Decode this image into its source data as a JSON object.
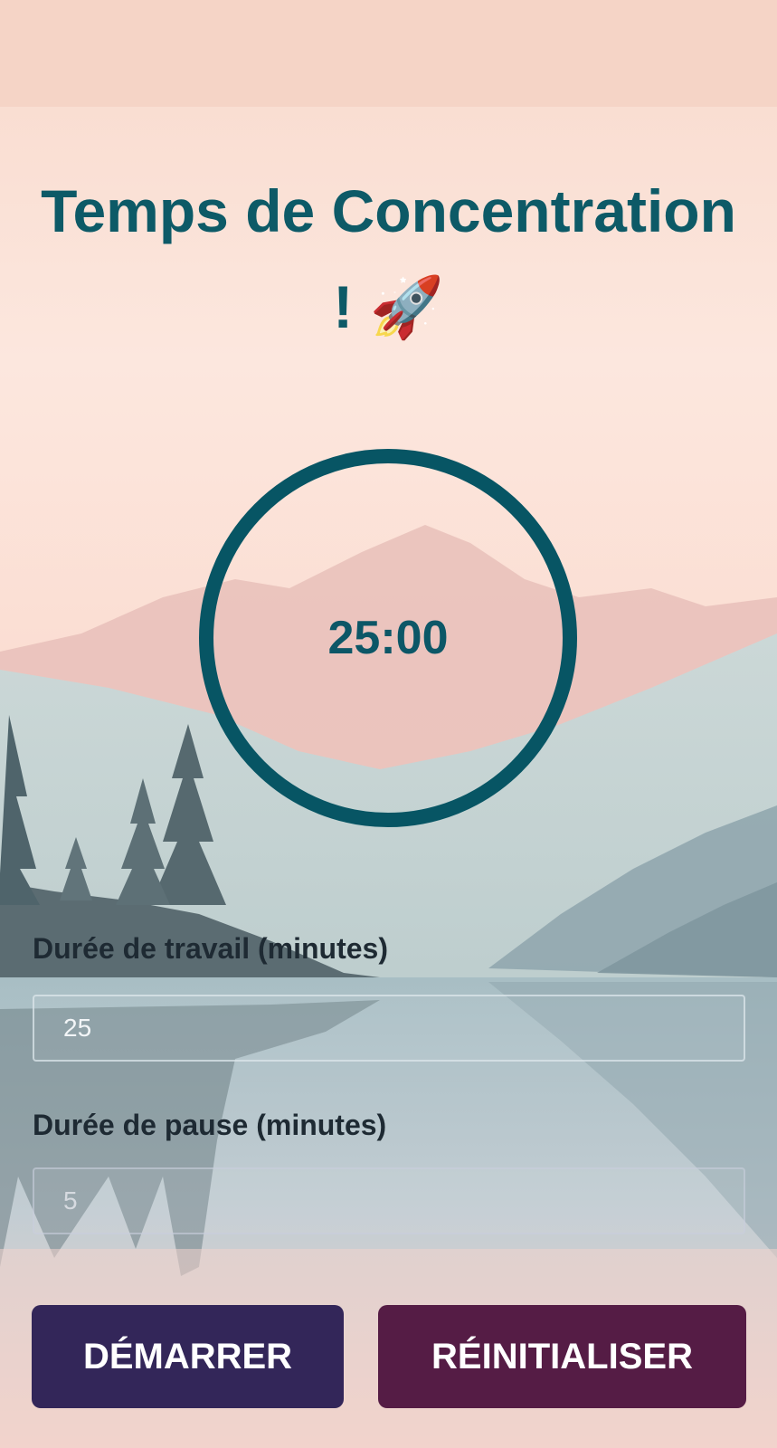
{
  "app": {
    "title_line1": "Temps de Concentration",
    "title_line2": "! 🚀",
    "timer_display": "25:00"
  },
  "settings": {
    "work_label": "Durée de travail (minutes)",
    "work_value": "25",
    "break_label": "Durée de pause (minutes)",
    "break_value": "5"
  },
  "actions": {
    "start_label": "DÉMARRER",
    "reset_label": "RÉINITIALISER"
  },
  "colors": {
    "accent": "#075564",
    "start_button": "#332659",
    "reset_button": "#551c45"
  }
}
